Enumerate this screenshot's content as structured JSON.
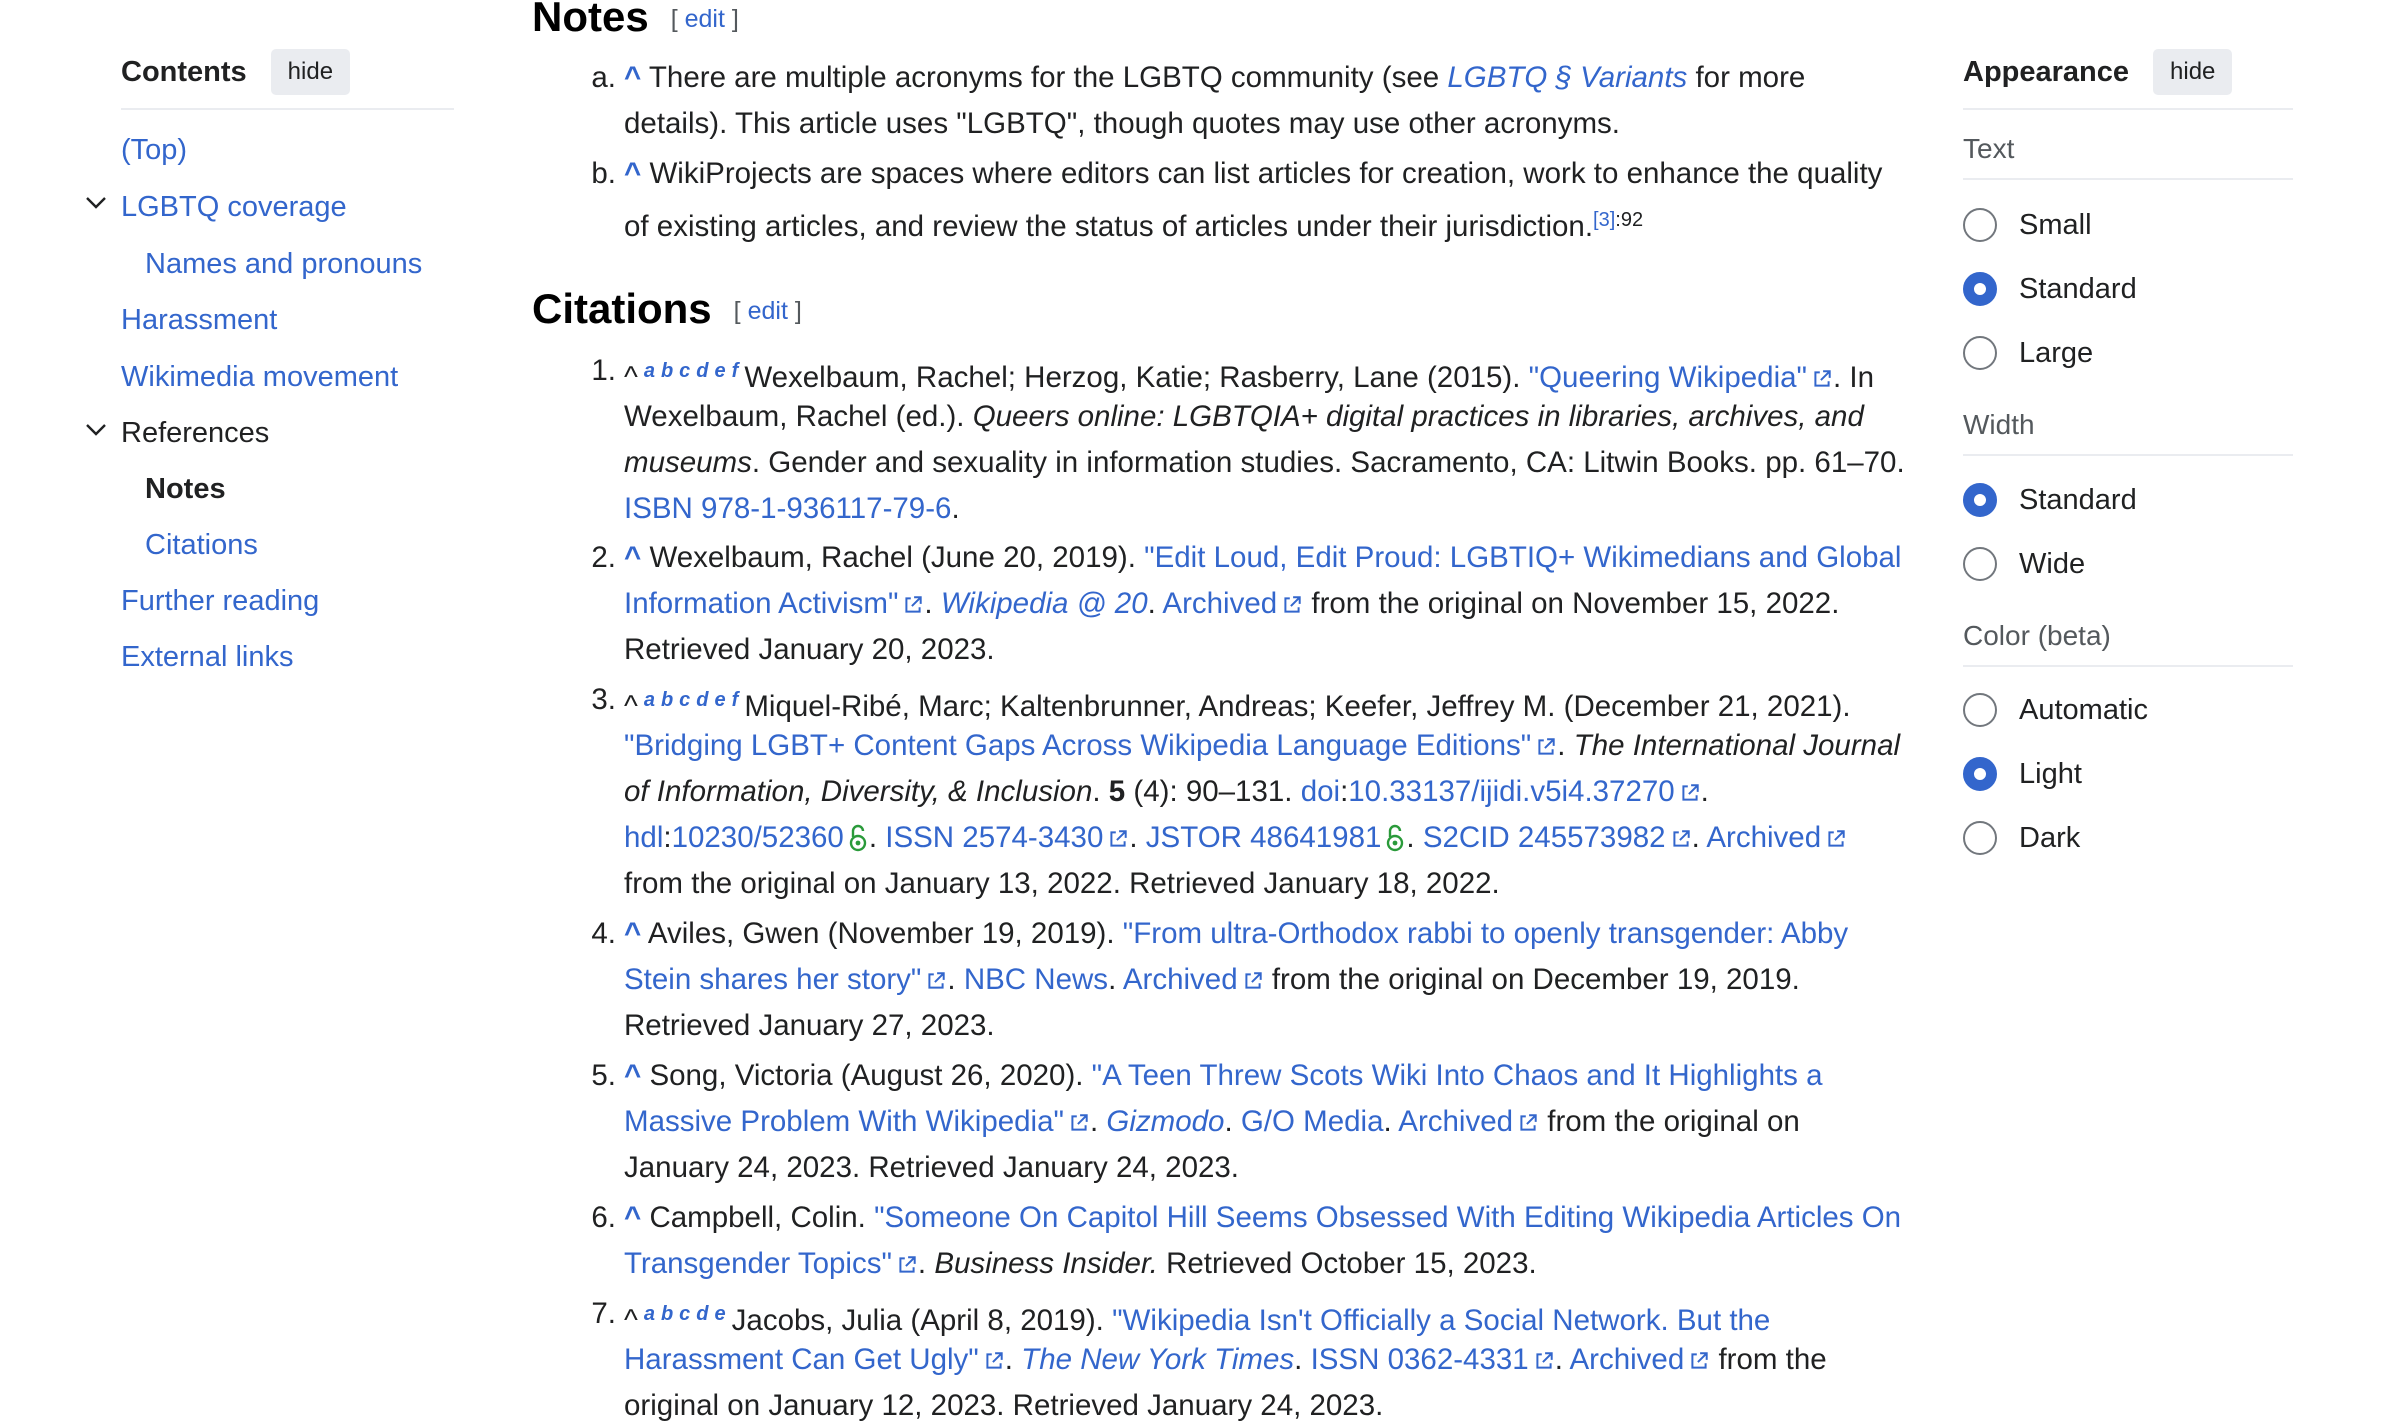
{
  "toc": {
    "title": "Contents",
    "hide_label": "hide",
    "items": [
      {
        "label": "(Top)"
      },
      {
        "label": "LGBTQ coverage"
      },
      {
        "label": "Names and pronouns"
      },
      {
        "label": "Harassment"
      },
      {
        "label": "Wikimedia movement"
      },
      {
        "label": "References"
      },
      {
        "label": "Notes"
      },
      {
        "label": "Citations"
      },
      {
        "label": "Further reading"
      },
      {
        "label": "External links"
      }
    ]
  },
  "appearance": {
    "title": "Appearance",
    "hide_label": "hide",
    "text": {
      "label": "Text",
      "options": [
        "Small",
        "Standard",
        "Large"
      ],
      "selected": "Standard"
    },
    "width": {
      "label": "Width",
      "options": [
        "Standard",
        "Wide"
      ],
      "selected": "Standard"
    },
    "color": {
      "label": "Color (beta)",
      "options": [
        "Automatic",
        "Light",
        "Dark"
      ],
      "selected": "Light"
    }
  },
  "notes": {
    "heading": "Notes",
    "edit_open": "[",
    "edit_label": "edit",
    "edit_close": "]",
    "a": {
      "marker": "a.",
      "caret": "^",
      "t1": "There are multiple acronyms for the LGBTQ community (see",
      "link": "LGBTQ § Variants",
      "t2": "for more",
      "t3": "details). This article uses \"LGBTQ\", though quotes may use other acronyms."
    },
    "b": {
      "marker": "b.",
      "caret": "^",
      "t1": "WikiProjects are spaces where editors can list articles for creation, work to enhance the quality",
      "t2": "of existing articles, and review the status of articles under their jurisdiction.",
      "ref": "[3]",
      "page": ":92"
    }
  },
  "citations": {
    "heading": "Citations",
    "edit_open": "[",
    "edit_label": "edit",
    "edit_close": "]",
    "c1": {
      "num": "1.",
      "caret": "^",
      "backlinks": "abcdef",
      "t1": "Wexelbaum, Rachel; Herzog, Katie; Rasberry, Lane (2015).",
      "link1": "\"Queering Wikipedia\"",
      "t2": ". In",
      "t3": "Wexelbaum, Rachel (ed.).",
      "it1": "Queers online: LGBTQIA+ digital practices in libraries, archives, and",
      "it2": "museums",
      "t4": ". Gender and sexuality in information studies. Sacramento, CA: Litwin Books. pp. 61–70.",
      "isbn": "ISBN 978-1-936117-79-6",
      "t5": "."
    },
    "c2": {
      "num": "2.",
      "caret": "^",
      "t1": "Wexelbaum, Rachel (June 20, 2019).",
      "link1": "\"Edit Loud, Edit Proud: LGBTIQ+ Wikimedians and Global",
      "link2": "Information Activism\"",
      "sep1": ".",
      "work": "Wikipedia @ 20",
      "sep2": ".",
      "archived": "Archived",
      "t2": "from the original on November 15, 2022.",
      "t3": "Retrieved January 20, 2023."
    },
    "c3": {
      "num": "3.",
      "caret": "^",
      "backlinks": "abcdef",
      "t1": "Miquel-Ribé, Marc; Kaltenbrunner, Andreas; Keefer, Jeffrey M. (December 21, 2021).",
      "link1": "\"Bridging LGBT+ Content Gaps Across Wikipedia Language Editions\"",
      "sep1": ".",
      "journal1": "The International Journal",
      "journal2": "of Information, Diversity, & Inclusion",
      "sep2": ".",
      "vol": "5",
      "t2": "(4): 90–131.",
      "doi_label": "doi",
      "doi": "10.33137/ijidi.v5i4.37270",
      "sep3": ".",
      "hdl_label": "hdl",
      "hdl": "10230/52360",
      "sep4": ".",
      "issn": "ISSN 2574-3430",
      "sep5": ".",
      "jstor": "JSTOR 48641981",
      "sep6": ".",
      "s2cid": "S2CID 245573982",
      "sep7": ".",
      "archived": "Archived",
      "t3": "from the original on January 13, 2022. Retrieved January 18, 2022."
    },
    "c4": {
      "num": "4.",
      "caret": "^",
      "t1": "Aviles, Gwen (November 19, 2019).",
      "link1": "\"From ultra-Orthodox rabbi to openly transgender: Abby",
      "link2": "Stein shares her story\"",
      "sep1": ".",
      "work": "NBC News",
      "sep2": ".",
      "archived": "Archived",
      "t2": "from the original on December 19, 2019.",
      "t3": "Retrieved January 27, 2023."
    },
    "c5": {
      "num": "5.",
      "caret": "^",
      "t1": "Song, Victoria (August 26, 2020).",
      "link1": "\"A Teen Threw Scots Wiki Into Chaos and It Highlights a",
      "link2": "Massive Problem With Wikipedia\"",
      "sep1": ".",
      "work": "Gizmodo",
      "sep2": ".",
      "pub": "G/O Media",
      "sep3": ".",
      "archived": "Archived",
      "t2": "from the original on",
      "t3": "January 24, 2023. Retrieved January 24, 2023."
    },
    "c6": {
      "num": "6.",
      "caret": "^",
      "t1": "Campbell, Colin.",
      "link1": "\"Someone On Capitol Hill Seems Obsessed With Editing Wikipedia Articles On",
      "link2": "Transgender Topics\"",
      "sep1": ".",
      "work": "Business Insider.",
      "t2": "Retrieved October 15, 2023."
    },
    "c7": {
      "num": "7.",
      "caret": "^",
      "backlinks": "abcde",
      "t1": "Jacobs, Julia (April 8, 2019).",
      "link1": "\"Wikipedia Isn't Officially a Social Network. But the",
      "link2": "Harassment Can Get Ugly\"",
      "sep1": ".",
      "work": "The New York Times",
      "sep2": ".",
      "issn": "ISSN 0362-4331",
      "sep3": ".",
      "archived": "Archived",
      "t2": "from the",
      "t3": "original on January 12, 2023. Retrieved January 24, 2023."
    }
  }
}
